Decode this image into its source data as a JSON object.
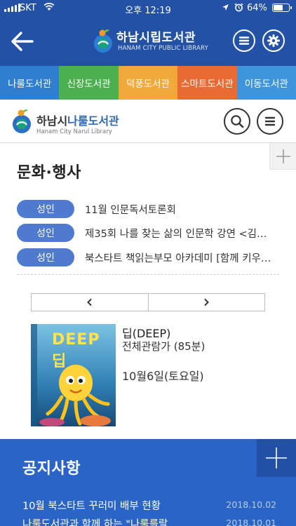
{
  "status_bar": {
    "carrier": "SKT",
    "time": "오후 12:19",
    "battery": "64%",
    "battery_level": 0.64
  },
  "header": {
    "title": "하남시립도서관",
    "subtitle": "HANAM CITY PUBLIC LIBRARY",
    "icons": [
      "back-arrow-icon",
      "menu-icon",
      "gear-icon"
    ]
  },
  "library_tabs": [
    {
      "label": "나룰도서관",
      "color": "#2f7ecf"
    },
    {
      "label": "신장도서관",
      "color": "#4caf50"
    },
    {
      "label": "덕풍도서관",
      "color": "#f0a93a"
    },
    {
      "label": "스마트도서관",
      "color": "#ea6a34"
    },
    {
      "label": "이동도서관",
      "color": "#3f95dc"
    }
  ],
  "subheader": {
    "name_prefix": "하남시",
    "name_main": "나룰도서관",
    "subtitle": "Hanam City Narul Library"
  },
  "events": {
    "title": "문화·행사",
    "items": [
      {
        "badge": "성인",
        "text": "11월 인문독서토론회"
      },
      {
        "badge": "성인",
        "text": "제35회 나를 찾는 삶의 인문학 강연 <김…"
      },
      {
        "badge": "성인",
        "text": "북스타트 책읽는부모 아카데미 [함께 키우…"
      }
    ],
    "movie": {
      "poster_title": "DEEP 딥",
      "title": "딥(DEEP)",
      "rating": "전체관람가 (85분)",
      "date": "10월6일(토요일)"
    }
  },
  "notice": {
    "title": "공지사항",
    "items": [
      {
        "text": "10월 북스타트 꾸러미 배부 현황",
        "date": "2018.10.02"
      },
      {
        "text": "나룰도서관과 함께 하는 \"나룰를랄…",
        "date": "2018.10.01"
      }
    ]
  },
  "colors": {
    "header_bg": "#2251a6",
    "badge_bg": "#4e7bd0",
    "notice_bg": "#2a64c6"
  }
}
